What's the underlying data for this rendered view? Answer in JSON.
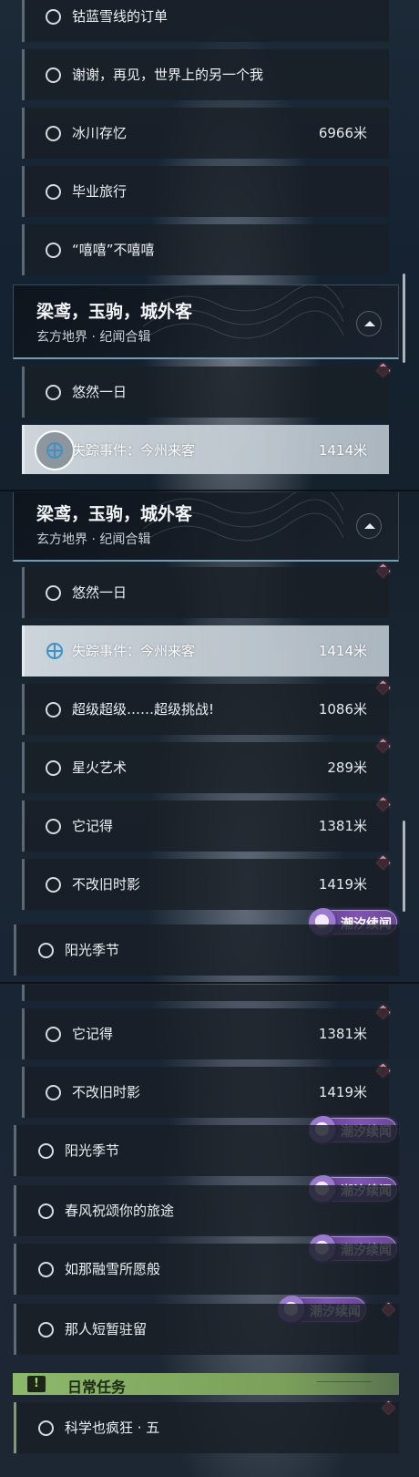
{
  "quests_panel_1": [
    {
      "name": "钴蓝雪线的订单",
      "dist": ""
    },
    {
      "name": "谢谢，再见，世界上的另一个我",
      "dist": ""
    },
    {
      "name": "冰川存忆",
      "dist": "6966米"
    },
    {
      "name": "毕业旅行",
      "dist": ""
    },
    {
      "name": "“嘻嘻”不嘻嘻",
      "dist": ""
    }
  ],
  "group": {
    "title": "梁鸢，玉驹，城外客",
    "subtitle": "玄方地界 · 纪闻合辑"
  },
  "quests_group_a": [
    {
      "name": "悠然一日",
      "dist": ""
    },
    {
      "name": "失踪事件：今州来客",
      "dist": "1414米"
    }
  ],
  "quests_group_b": [
    {
      "name": "悠然一日",
      "dist": ""
    },
    {
      "name": "失踪事件：今州来客",
      "dist": "1414米"
    },
    {
      "name": "超级超级……超级挑战!",
      "dist": "1086米"
    },
    {
      "name": "星火艺术",
      "dist": "289米"
    },
    {
      "name": "它记得",
      "dist": "1381米"
    },
    {
      "name": "不改旧时影",
      "dist": "1419米"
    }
  ],
  "sub_quests_b": [
    {
      "name": "阳光季节",
      "dist": ""
    }
  ],
  "quests_panel_3": [
    {
      "name": "它记得",
      "dist": "1381米"
    },
    {
      "name": "不改旧时影",
      "dist": "1419米"
    }
  ],
  "sub_quests_c": [
    {
      "name": "阳光季节"
    },
    {
      "name": "春风祝颂你的旅途"
    },
    {
      "name": "如那融雪所愿般"
    },
    {
      "name": "那人短暂驻留"
    }
  ],
  "badge_label": "潮汐续闻",
  "daily": {
    "icon": "!",
    "title": "日常任务",
    "quests": [
      {
        "name": "科学也疯狂 · 五"
      }
    ]
  },
  "icons": {
    "radio": "radio-icon",
    "target": "crosshair-target-icon",
    "marker": "map-marker-diamond-icon",
    "collapse": "chevron-up-icon",
    "badge": "tide-emblem-icon",
    "daily": "exclamation-icon"
  },
  "colors": {
    "marker": "#e25061",
    "badge": "#7d55b0",
    "daily_bar": "#8db86a",
    "selected_row": "#d6dee4"
  }
}
